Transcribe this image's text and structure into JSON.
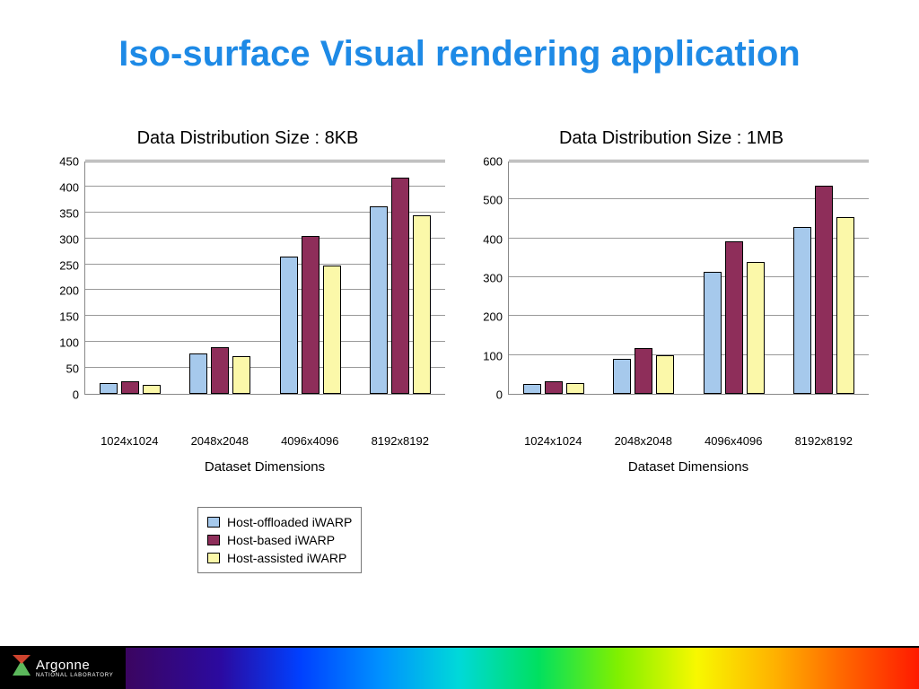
{
  "title": "Iso-surface Visual rendering application",
  "legend": {
    "offloaded": "Host-offloaded iWARP",
    "based": "Host-based iWARP",
    "assisted": "Host-assisted iWARP"
  },
  "footer_logo": {
    "main": "Argonne",
    "sub": "NATIONAL LABORATORY"
  },
  "chart_data": [
    {
      "type": "bar",
      "title": "Data Distribution Size : 8KB",
      "xlabel": "Dataset Dimensions",
      "ylabel": "",
      "categories": [
        "1024x1024",
        "2048x2048",
        "4096x4096",
        "8192x8192"
      ],
      "series": [
        {
          "name": "Host-offloaded iWARP",
          "values": [
            20,
            78,
            265,
            362
          ]
        },
        {
          "name": "Host-based iWARP",
          "values": [
            25,
            90,
            305,
            417
          ]
        },
        {
          "name": "Host-assisted iWARP",
          "values": [
            18,
            72,
            248,
            345
          ]
        }
      ],
      "ylim": [
        0,
        450
      ],
      "yticks": [
        0,
        50,
        100,
        150,
        200,
        250,
        300,
        350,
        400,
        450
      ]
    },
    {
      "type": "bar",
      "title": "Data Distribution Size : 1MB",
      "xlabel": "Dataset Dimensions",
      "ylabel": "",
      "categories": [
        "1024x1024",
        "2048x2048",
        "4096x4096",
        "8192x8192"
      ],
      "series": [
        {
          "name": "Host-offloaded iWARP",
          "values": [
            25,
            90,
            315,
            430
          ]
        },
        {
          "name": "Host-based iWARP",
          "values": [
            32,
            118,
            392,
            535
          ]
        },
        {
          "name": "Host-assisted iWARP",
          "values": [
            28,
            100,
            340,
            455
          ]
        }
      ],
      "ylim": [
        0,
        600
      ],
      "yticks": [
        0,
        100,
        200,
        300,
        400,
        500,
        600
      ]
    }
  ]
}
